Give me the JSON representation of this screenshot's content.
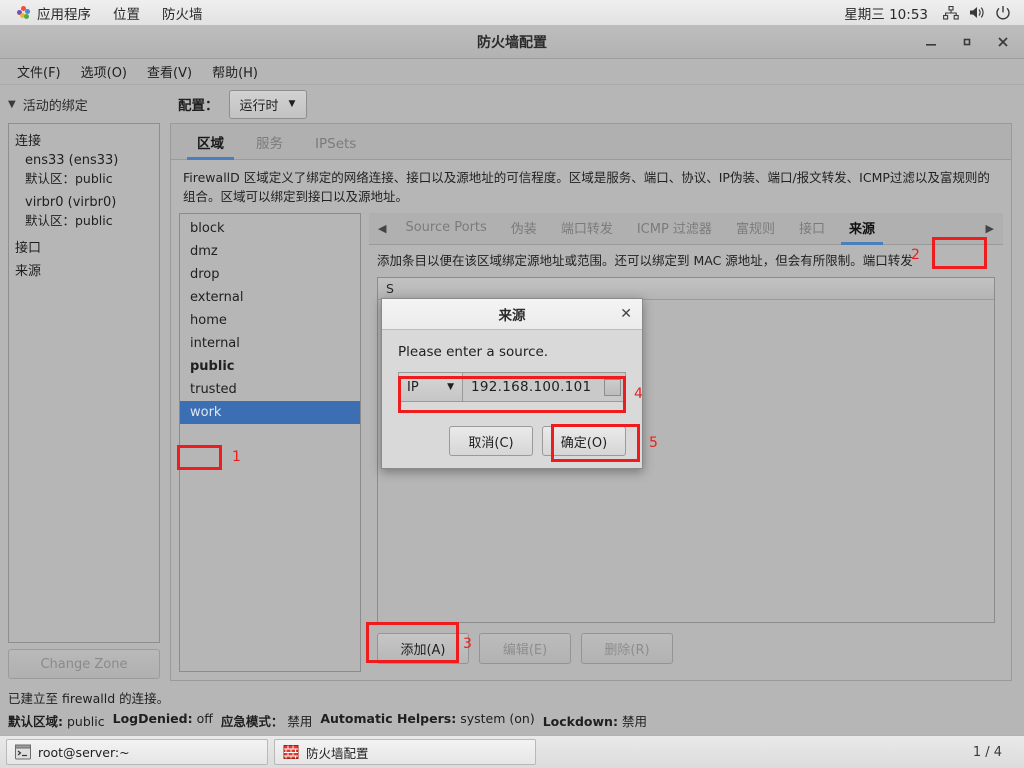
{
  "desktop": {
    "panel": {
      "apps_label": "应用程序",
      "places_label": "位置",
      "app_name_label": "防火墙",
      "clock": "星期三 10:53",
      "icons": [
        "network-icon",
        "volume-icon",
        "power-icon"
      ]
    },
    "taskbar": {
      "tasks": [
        {
          "label": "root@server:~",
          "icon": "terminal-icon"
        },
        {
          "label": "防火墙配置",
          "icon": "firewall-icon"
        }
      ],
      "workspace": "1 / 4"
    }
  },
  "window": {
    "title": "防火墙配置",
    "controls": {
      "minimize": "_",
      "maximize": "□",
      "close": "✕"
    },
    "menubar": [
      "文件(F)",
      "选项(O)",
      "查看(V)",
      "帮助(H)"
    ],
    "toolbar": {
      "active_bindings_label": "活动的绑定",
      "config_label": "配置：",
      "config_value": "运行时"
    }
  },
  "left_panel": {
    "connections_header": "连接",
    "connections": [
      {
        "name": "ens33 (ens33)",
        "sub": "默认区：public"
      },
      {
        "name": "virbr0 (virbr0)",
        "sub": "默认区：public"
      }
    ],
    "interfaces_header": "接口",
    "sources_header": "来源",
    "change_zone_label": "Change Zone"
  },
  "main": {
    "tabs": [
      {
        "label": "区域",
        "selected": true
      },
      {
        "label": "服务",
        "selected": false
      },
      {
        "label": "IPSets",
        "selected": false
      }
    ],
    "description": "FirewallD 区域定义了绑定的网络连接、接口以及源地址的可信程度。区域是服务、端口、协议、IP伪装、端口/报文转发、ICMP过滤以及富规则的组合。区域可以绑定到接口以及源地址。",
    "zones": [
      {
        "label": "block",
        "state": "normal"
      },
      {
        "label": "dmz",
        "state": "normal"
      },
      {
        "label": "drop",
        "state": "normal"
      },
      {
        "label": "external",
        "state": "normal"
      },
      {
        "label": "home",
        "state": "normal"
      },
      {
        "label": "internal",
        "state": "normal"
      },
      {
        "label": "public",
        "state": "bold"
      },
      {
        "label": "trusted",
        "state": "normal"
      },
      {
        "label": "work",
        "state": "selected"
      }
    ],
    "subtabs": {
      "scroll_left": "◀",
      "scroll_right": "▶",
      "items": [
        {
          "label": "Source Ports",
          "selected": false
        },
        {
          "label": "伪装",
          "selected": false
        },
        {
          "label": "端口转发",
          "selected": false
        },
        {
          "label": "ICMP 过滤器",
          "selected": false
        },
        {
          "label": "富规则",
          "selected": false
        },
        {
          "label": "接口",
          "selected": false
        },
        {
          "label": "来源",
          "selected": true
        }
      ]
    },
    "sub_description": "添加条目以便在该区域绑定源地址或范围。还可以绑定到 MAC 源地址，但会有所限制。端口转发",
    "table_header": "S",
    "buttons": [
      {
        "label": "添加(A)",
        "enabled": true
      },
      {
        "label": "编辑(E)",
        "enabled": false
      },
      {
        "label": "删除(R)",
        "enabled": false
      }
    ]
  },
  "dialog": {
    "title": "来源",
    "close_label": "✕",
    "prompt": "Please enter a source.",
    "type_value": "IP",
    "source_value": "192.168.100.101",
    "cancel_label": "取消(C)",
    "ok_label": "确定(O)"
  },
  "status": {
    "line1": "已建立至 firewalld 的连接。",
    "items": [
      {
        "key": "默认区域:",
        "value": "public"
      },
      {
        "key": "LogDenied:",
        "value": "off"
      },
      {
        "key": "应急模式：",
        "value": "禁用"
      },
      {
        "key": "Automatic Helpers:",
        "value": "system (on)"
      },
      {
        "key": "Lockdown:",
        "value": "禁用"
      }
    ]
  },
  "annotations": {
    "color": "#ee1c1c",
    "markers": [
      {
        "num": "1"
      },
      {
        "num": "2"
      },
      {
        "num": "3"
      },
      {
        "num": "4"
      },
      {
        "num": "5"
      }
    ]
  }
}
